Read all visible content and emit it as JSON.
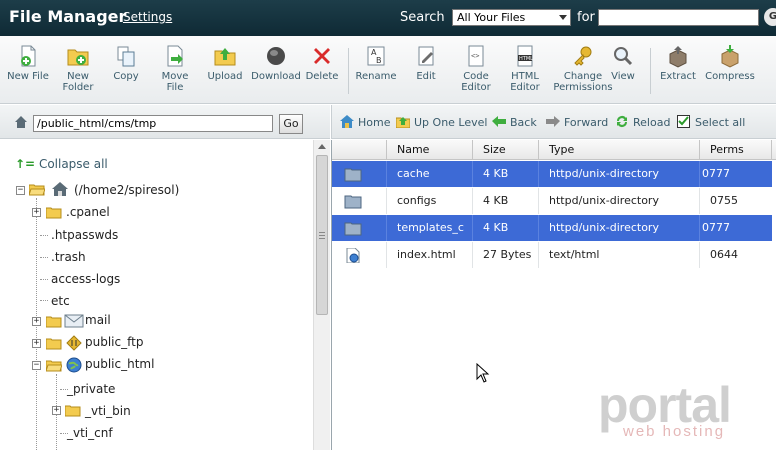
{
  "header": {
    "title": "File Manager",
    "settings_label": "Settings",
    "search_label": "Search",
    "search_scope": "All Your Files",
    "for_label": "for",
    "search_value": ""
  },
  "toolbar": {
    "new_file": "New File",
    "new_folder": "New Folder",
    "copy": "Copy",
    "move_file": "Move File",
    "upload": "Upload",
    "download": "Download",
    "delete": "Delete",
    "rename": "Rename",
    "edit": "Edit",
    "code_editor": "Code Editor",
    "html_editor": "HTML Editor",
    "change_permissions": "Change Permissions",
    "view": "View",
    "extract": "Extract",
    "compress": "Compress"
  },
  "pathbar": {
    "path": "/public_html/cms/tmp",
    "go_label": "Go"
  },
  "navbar": {
    "home": "Home",
    "up_one_level": "Up One Level",
    "back": "Back",
    "forward": "Forward",
    "reload": "Reload",
    "select_all": "Select all"
  },
  "tree": {
    "collapse_all": "Collapse all",
    "root": "(/home2/spiresol)",
    "nodes": [
      ".cpanel",
      ".htpasswds",
      ".trash",
      "access-logs",
      "etc",
      "mail",
      "public_ftp",
      "public_html",
      "_private",
      "_vti_bin",
      "_vti_cnf"
    ]
  },
  "files": {
    "columns": [
      "Name",
      "Size",
      "Type",
      "Perms"
    ],
    "rows": [
      {
        "name": "cache",
        "size": "4 KB",
        "type": "httpd/unix-directory",
        "perms": "0777",
        "selected": true,
        "kind": "folder"
      },
      {
        "name": "configs",
        "size": "4 KB",
        "type": "httpd/unix-directory",
        "perms": "0755",
        "selected": false,
        "kind": "folder"
      },
      {
        "name": "templates_c",
        "size": "4 KB",
        "type": "httpd/unix-directory",
        "perms": "0777",
        "selected": true,
        "kind": "folder"
      },
      {
        "name": "index.html",
        "size": "27 Bytes",
        "type": "text/html",
        "perms": "0644",
        "selected": false,
        "kind": "html"
      }
    ]
  },
  "watermark": {
    "logo": "portal",
    "sub": "web hosting"
  },
  "colors": {
    "topbar": "#163643",
    "selection": "#3d6ad6",
    "link": "#3a5b6b"
  }
}
